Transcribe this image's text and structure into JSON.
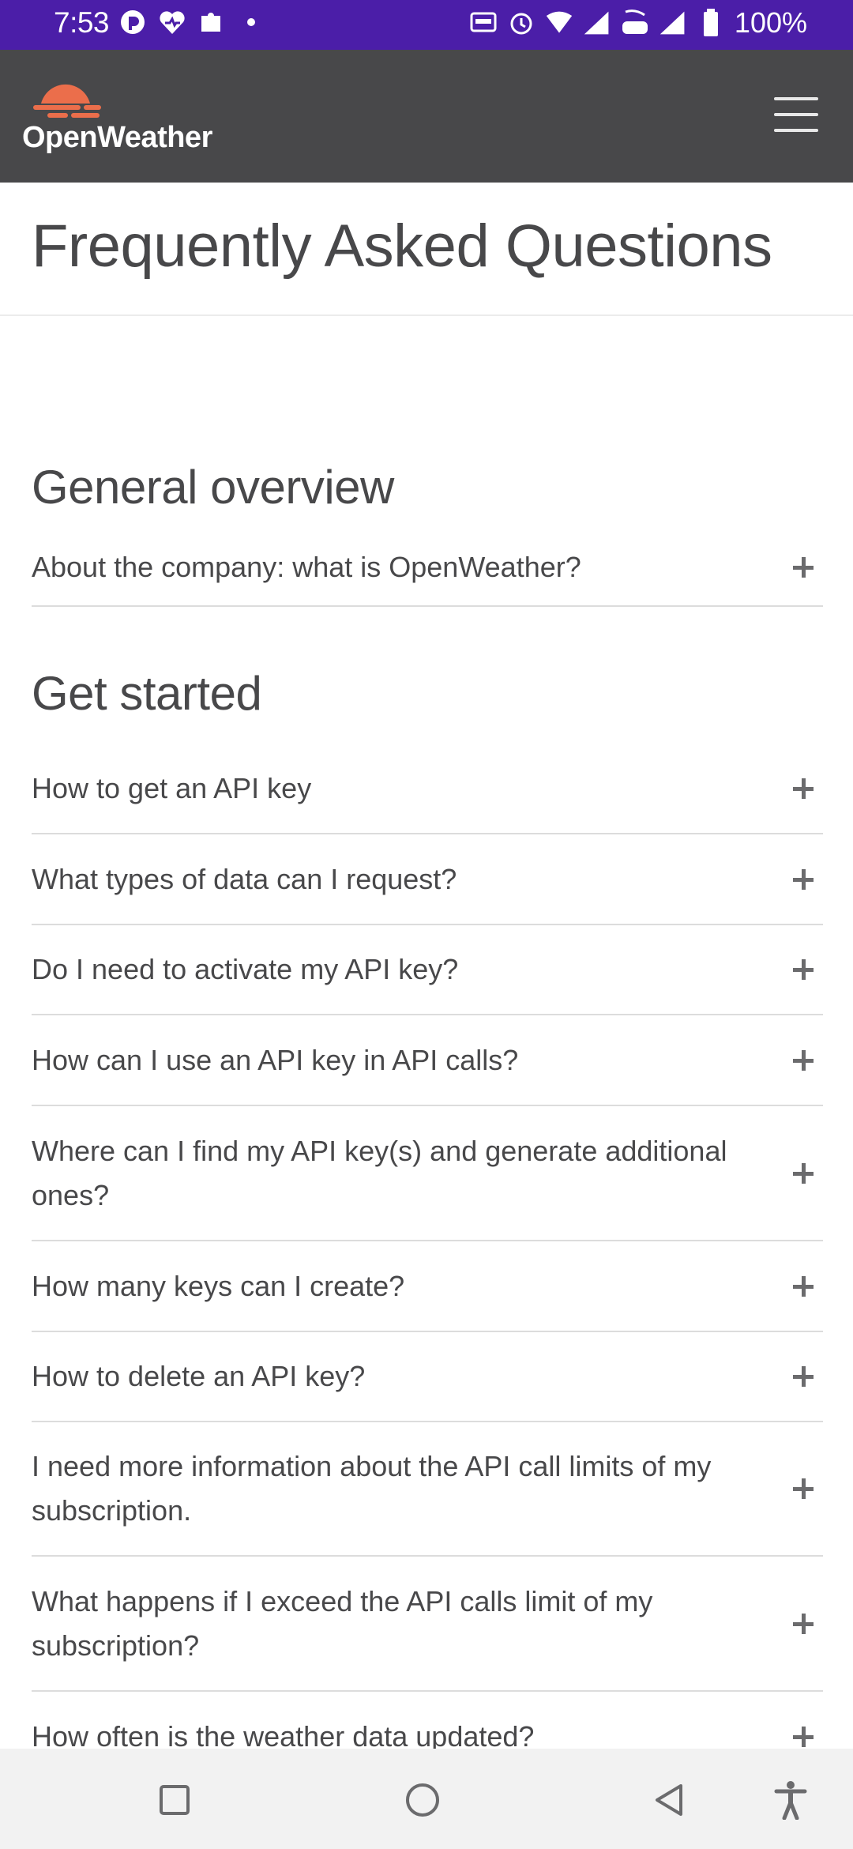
{
  "status_bar": {
    "time": "7:53",
    "battery": "100%"
  },
  "header": {
    "logo_text": "OpenWeather",
    "brand_color": "#eb6e4b"
  },
  "page": {
    "title": "Frequently Asked Questions"
  },
  "sections": [
    {
      "heading": "General overview",
      "questions": [
        "About the company: what is OpenWeather?"
      ]
    },
    {
      "heading": "Get started",
      "questions": [
        "How to get an API key",
        "What types of data can I request?",
        "Do I need to activate my API key?",
        "How can I use an API key in API calls?",
        "Where can I find my API key(s) and generate additional ones?",
        "How many keys can I create?",
        "How to delete an API key?",
        "I need more information about the API call limits of my subscription.",
        "What happens if I exceed the API calls limit of my subscription?",
        "How often is the weather data updated?"
      ]
    }
  ]
}
